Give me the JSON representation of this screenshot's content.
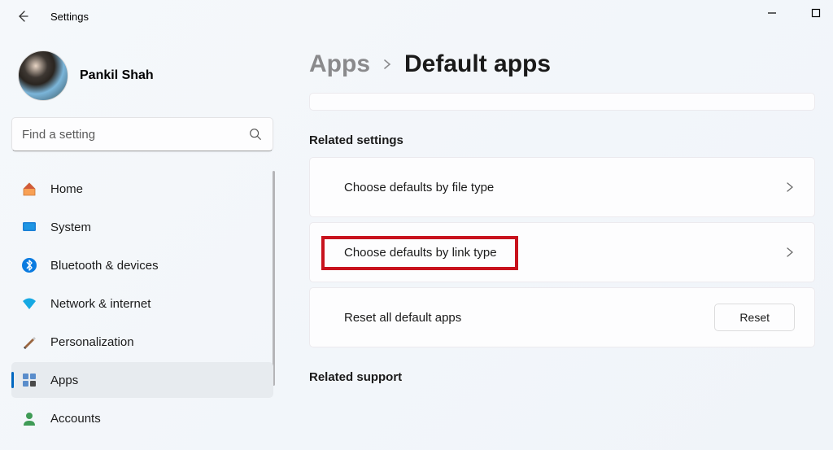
{
  "window": {
    "title": "Settings"
  },
  "user": {
    "name": "Pankil Shah"
  },
  "search": {
    "placeholder": "Find a setting"
  },
  "sidebar": {
    "items": [
      {
        "label": "Home",
        "icon": "home"
      },
      {
        "label": "System",
        "icon": "system"
      },
      {
        "label": "Bluetooth & devices",
        "icon": "bluetooth"
      },
      {
        "label": "Network & internet",
        "icon": "network"
      },
      {
        "label": "Personalization",
        "icon": "personalization"
      },
      {
        "label": "Apps",
        "icon": "apps"
      },
      {
        "label": "Accounts",
        "icon": "accounts"
      }
    ]
  },
  "breadcrumb": {
    "parent": "Apps",
    "current": "Default apps"
  },
  "sections": {
    "related_settings": {
      "header": "Related settings",
      "items": [
        {
          "label": "Choose defaults by file type"
        },
        {
          "label": "Choose defaults by link type"
        },
        {
          "label": "Reset all default apps",
          "action": "Reset"
        }
      ]
    },
    "related_support": {
      "header": "Related support"
    }
  }
}
